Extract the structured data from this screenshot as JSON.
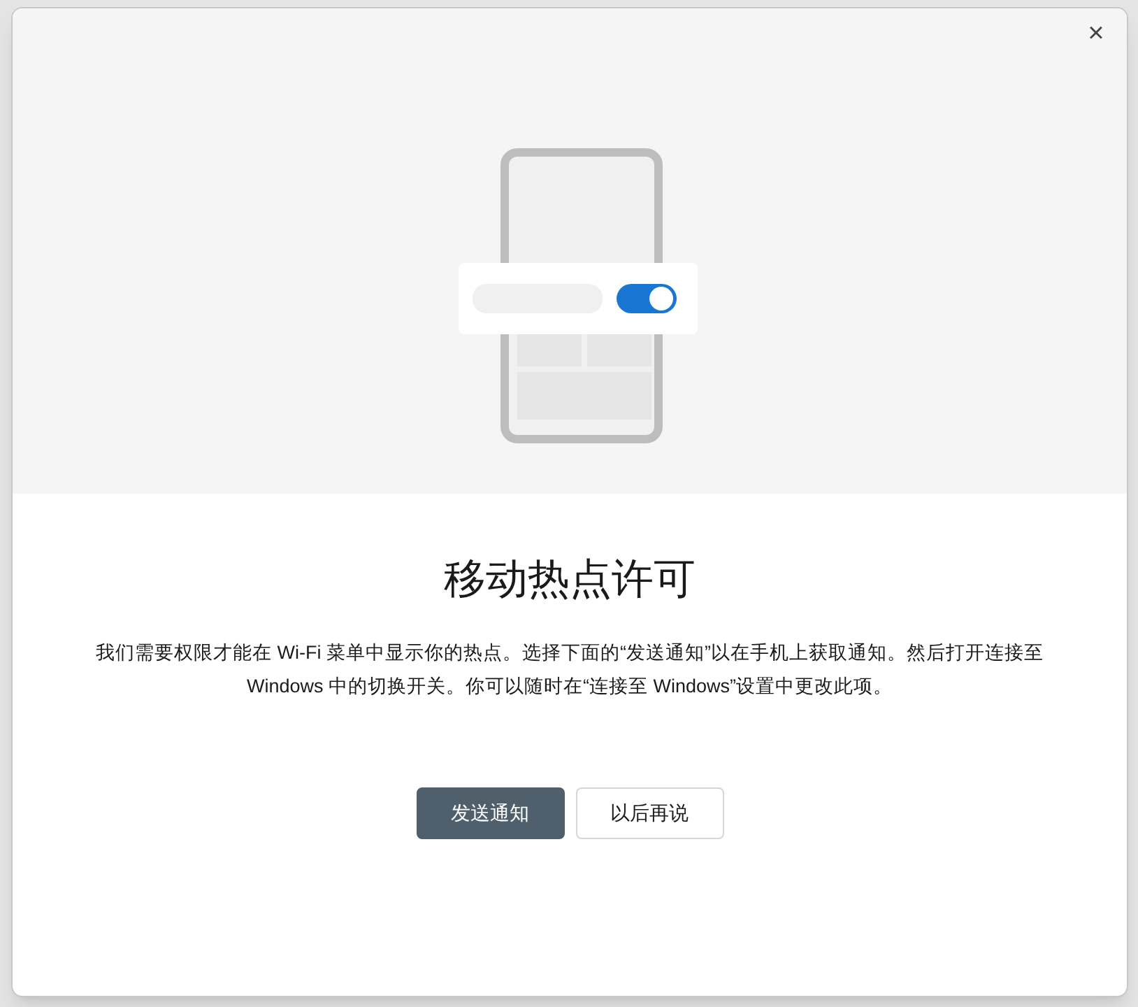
{
  "dialog": {
    "close": "×",
    "title": "移动热点许可",
    "message": "我们需要权限才能在 Wi-Fi 菜单中显示你的热点。选择下面的“发送通知”以在手机上获取通知。然后打开连接至 Windows 中的切换开关。你可以随时在“连接至 Windows”设置中更改此项。",
    "buttons": [
      {
        "label": "发送通知",
        "kind": "primary"
      },
      {
        "label": "以后再说",
        "kind": "secondary"
      }
    ]
  }
}
